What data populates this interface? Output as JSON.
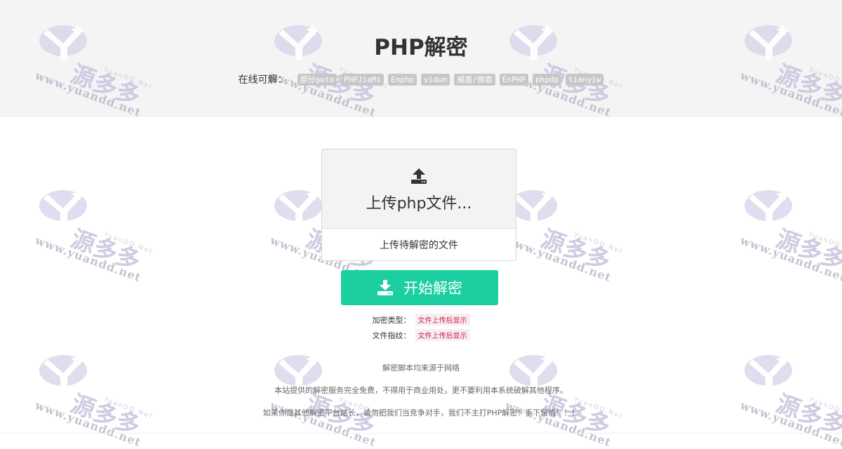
{
  "header": {
    "title": "PHP解密",
    "support_label": "在线可解：",
    "tags": [
      "部分goto",
      "PHPJiaMi",
      "Enphp",
      "vidun",
      "威盾/微盾",
      "EnPHP",
      "phpdp",
      "tianyiw"
    ]
  },
  "upload": {
    "icon": "upload-icon",
    "label": "上传php文件...",
    "hint": "上传待解密的文件"
  },
  "decrypt": {
    "icon": "download-icon",
    "label": "开始解密",
    "color": "#1ccfa0"
  },
  "info": {
    "type_label": "加密类型：",
    "type_value": "文件上传后显示",
    "fingerprint_label": "文件指纹：",
    "fingerprint_value": "文件上传后显示"
  },
  "notes": [
    "解密脚本均来源于网络",
    "本站提供的解密服务完全免费，不得用于商业用处，更不要利用本系统破解其他程序。",
    "如果你是其他解密平台站长，请勿把我们当竞争对手，我们不主打PHP解密！手下留情！！！"
  ],
  "watermark": {
    "url": "www.yuandd.net",
    "logo": "源多多",
    "sub": "YuanDD.Net"
  }
}
